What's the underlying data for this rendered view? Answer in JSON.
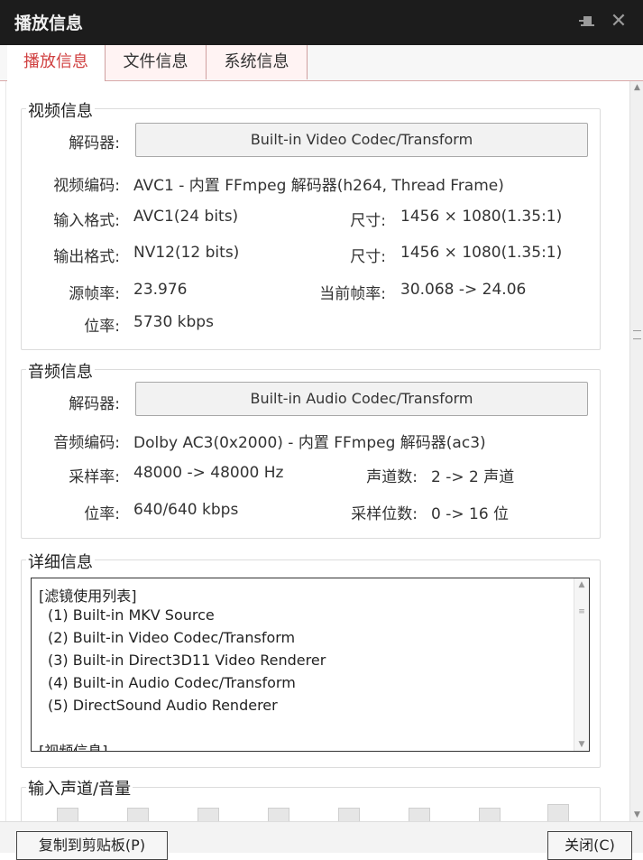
{
  "window": {
    "title": "播放信息",
    "pin_icon": "pin-icon",
    "close_icon": "close-icon"
  },
  "tabs": [
    {
      "label": "播放信息",
      "active": true
    },
    {
      "label": "文件信息",
      "active": false
    },
    {
      "label": "系统信息",
      "active": false
    }
  ],
  "video": {
    "legend": "视频信息",
    "decoder_label": "解码器:",
    "decoder_button": "Built-in Video Codec/Transform",
    "codec_label": "视频编码:",
    "codec_value": "AVC1 - 内置 FFmpeg 解码器(h264, Thread Frame)",
    "input_format_label": "输入格式:",
    "input_format_value": "AVC1(24 bits)",
    "input_size_label": "尺寸:",
    "input_size_value": "1456 × 1080(1.35:1)",
    "output_format_label": "输出格式:",
    "output_format_value": "NV12(12 bits)",
    "output_size_label": "尺寸:",
    "output_size_value": "1456 × 1080(1.35:1)",
    "source_fps_label": "源帧率:",
    "source_fps_value": "23.976",
    "current_fps_label": "当前帧率:",
    "current_fps_value": "30.068 -> 24.06",
    "bitrate_label": "位率:",
    "bitrate_value": "5730 kbps"
  },
  "audio": {
    "legend": "音频信息",
    "decoder_label": "解码器:",
    "decoder_button": "Built-in Audio Codec/Transform",
    "codec_label": "音频编码:",
    "codec_value": "Dolby AC3(0x2000) - 内置 FFmpeg 解码器(ac3)",
    "samplerate_label": "采样率:",
    "samplerate_value": "48000 -> 48000 Hz",
    "channels_label": "声道数:",
    "channels_value": "2 -> 2 声道",
    "bitrate_label": "位率:",
    "bitrate_value": "640/640 kbps",
    "bits_label": "采样位数:",
    "bits_value": "0 -> 16 位"
  },
  "details": {
    "legend": "详细信息",
    "lines": [
      "[滤镜使用列表]",
      "  (1) Built-in MKV Source",
      "  (2) Built-in Video Codec/Transform",
      "  (3) Built-in Direct3D11 Video Renderer",
      "  (4) Built-in Audio Codec/Transform",
      "  (5) DirectSound Audio Renderer",
      "",
      "[视频信息]"
    ]
  },
  "volume": {
    "legend": "输入声道/音量"
  },
  "footer": {
    "copy_button": "复制到剪贴板(P)",
    "close_button": "关闭(C)"
  },
  "colors": {
    "titlebar_bg": "#1c1c1c",
    "active_tab_text": "#d04040"
  }
}
